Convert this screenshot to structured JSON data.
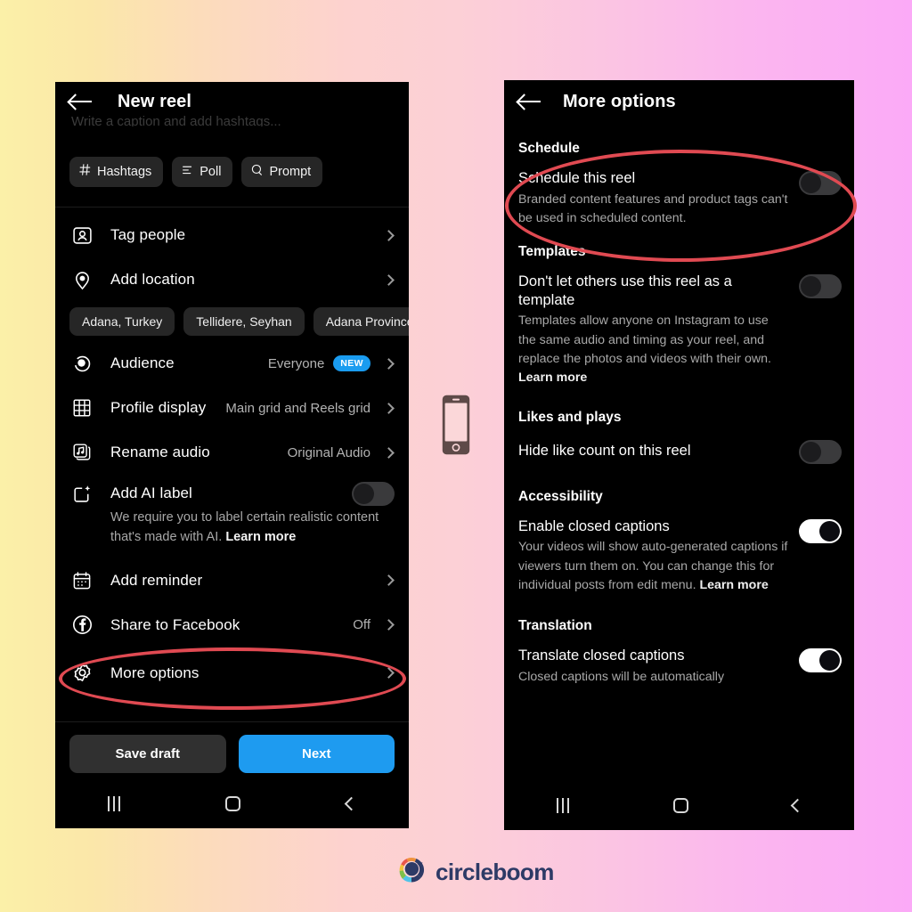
{
  "background": {
    "left_color": "#fbf0a8",
    "mid_color": "#fcd0d6",
    "right_color": "#fbaaf7"
  },
  "brand": {
    "name": "circleboom",
    "logo_icon": "circleboom-logo-icon"
  },
  "center_icon": {
    "name": "mobile-phone-icon"
  },
  "accent": {
    "primary_button": "#1e9bf0",
    "badge": "#1a9cf0",
    "annotation": "#e04a52"
  },
  "left_phone": {
    "header": {
      "back_icon": "back-arrow-icon",
      "title": "New reel"
    },
    "caption_placeholder": "Write a caption and add hashtags...",
    "chips": [
      {
        "icon": "hashtag-icon",
        "label": "Hashtags"
      },
      {
        "icon": "poll-icon",
        "label": "Poll"
      },
      {
        "icon": "prompt-icon",
        "label": "Prompt"
      }
    ],
    "rows": [
      {
        "icon": "tag-people-icon",
        "label": "Tag people",
        "value": "",
        "chevron": true
      },
      {
        "icon": "location-pin-icon",
        "label": "Add location",
        "value": "",
        "chevron": true
      }
    ],
    "location_suggestions": [
      "Adana, Turkey",
      "Tellidere, Seyhan",
      "Adana Province"
    ],
    "rows2": [
      {
        "icon": "audience-eye-icon",
        "label": "Audience",
        "value": "Everyone",
        "badge": "NEW",
        "chevron": true
      },
      {
        "icon": "grid-icon",
        "label": "Profile display",
        "value": "Main grid and Reels grid",
        "chevron": true
      },
      {
        "icon": "music-note-icon",
        "label": "Rename audio",
        "value": "Original Audio",
        "chevron": true
      }
    ],
    "ai_label": {
      "icon": "ai-sparkle-icon",
      "label": "Add AI label",
      "description": "We require you to label certain realistic content that's made with AI.",
      "link": "Learn more",
      "toggle": "off"
    },
    "rows3": [
      {
        "icon": "calendar-icon",
        "label": "Add reminder",
        "value": "",
        "chevron": true
      },
      {
        "icon": "facebook-icon",
        "label": "Share to Facebook",
        "value": "Off",
        "chevron": true
      },
      {
        "icon": "gear-icon",
        "label": "More options",
        "value": "",
        "chevron": true
      }
    ],
    "actions": {
      "save_draft": "Save draft",
      "next": "Next"
    },
    "nav": {
      "recents": "recents-icon",
      "home": "home-icon",
      "back": "back-icon"
    }
  },
  "right_phone": {
    "header": {
      "back_icon": "back-arrow-icon",
      "title": "More options"
    },
    "sections": [
      {
        "title": "Schedule",
        "options": [
          {
            "title": "Schedule this reel",
            "description": "Branded content features and product tags can't be used in scheduled content.",
            "link": "",
            "toggle": "off"
          }
        ]
      },
      {
        "title": "Templates",
        "options": [
          {
            "title": "Don't let others use this reel as a template",
            "description": "Templates allow anyone on Instagram to use the same audio and timing as your reel, and replace the photos and videos with their own.",
            "link": "Learn more",
            "toggle": "off"
          }
        ]
      },
      {
        "title": "Likes and plays",
        "options": [
          {
            "title": "Hide like count on this reel",
            "description": "",
            "link": "",
            "toggle": "off"
          }
        ]
      },
      {
        "title": "Accessibility",
        "options": [
          {
            "title": "Enable closed captions",
            "description": "Your videos will show auto-generated captions if viewers turn them on. You can change this for individual posts from edit menu.",
            "link": "Learn more",
            "toggle": "on"
          }
        ]
      },
      {
        "title": "Translation",
        "options": [
          {
            "title": "Translate closed captions",
            "description": "Closed captions will be automatically",
            "link": "",
            "toggle": "on"
          }
        ]
      }
    ],
    "nav": {
      "recents": "recents-icon",
      "home": "home-icon",
      "back": "back-icon"
    }
  }
}
